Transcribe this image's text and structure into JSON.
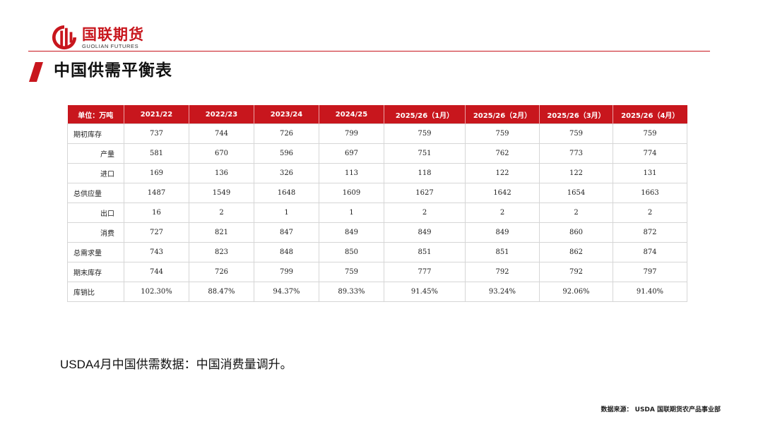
{
  "brand": {
    "name_cn": "国联期货",
    "name_en": "GUOLIAN FUTURES",
    "color": "#c8161d"
  },
  "page_title": "中国供需平衡表",
  "table": {
    "unit_header": "单位：万吨",
    "columns": [
      "2021/22",
      "2022/23",
      "2023/24",
      "2024/25",
      "2025/26（1月）",
      "2025/26（2月）",
      "2025/26（3月）",
      "2025/26（4月）"
    ],
    "rows": [
      {
        "label": "期初库存",
        "indent": false,
        "values": [
          "737",
          "744",
          "726",
          "799",
          "759",
          "759",
          "759",
          "759"
        ]
      },
      {
        "label": "产量",
        "indent": true,
        "values": [
          "581",
          "670",
          "596",
          "697",
          "751",
          "762",
          "773",
          "774"
        ]
      },
      {
        "label": "进口",
        "indent": true,
        "values": [
          "169",
          "136",
          "326",
          "113",
          "118",
          "122",
          "122",
          "131"
        ]
      },
      {
        "label": "总供应量",
        "indent": false,
        "values": [
          "1487",
          "1549",
          "1648",
          "1609",
          "1627",
          "1642",
          "1654",
          "1663"
        ]
      },
      {
        "label": "出口",
        "indent": true,
        "values": [
          "16",
          "2",
          "1",
          "1",
          "2",
          "2",
          "2",
          "2"
        ]
      },
      {
        "label": "消费",
        "indent": true,
        "values": [
          "727",
          "821",
          "847",
          "849",
          "849",
          "849",
          "860",
          "872"
        ]
      },
      {
        "label": "总需求量",
        "indent": false,
        "values": [
          "743",
          "823",
          "848",
          "850",
          "851",
          "851",
          "862",
          "874"
        ]
      },
      {
        "label": "期末库存",
        "indent": false,
        "values": [
          "744",
          "726",
          "799",
          "759",
          "777",
          "792",
          "792",
          "797"
        ]
      },
      {
        "label": "库销比",
        "indent": false,
        "values": [
          "102.30%",
          "88.47%",
          "94.37%",
          "89.33%",
          "91.45%",
          "93.24%",
          "92.06%",
          "91.40%"
        ]
      }
    ]
  },
  "note": "USDA4月中国供需数据：中国消费量调升。",
  "source": "数据来源： USDA 国联期货农产品事业部"
}
